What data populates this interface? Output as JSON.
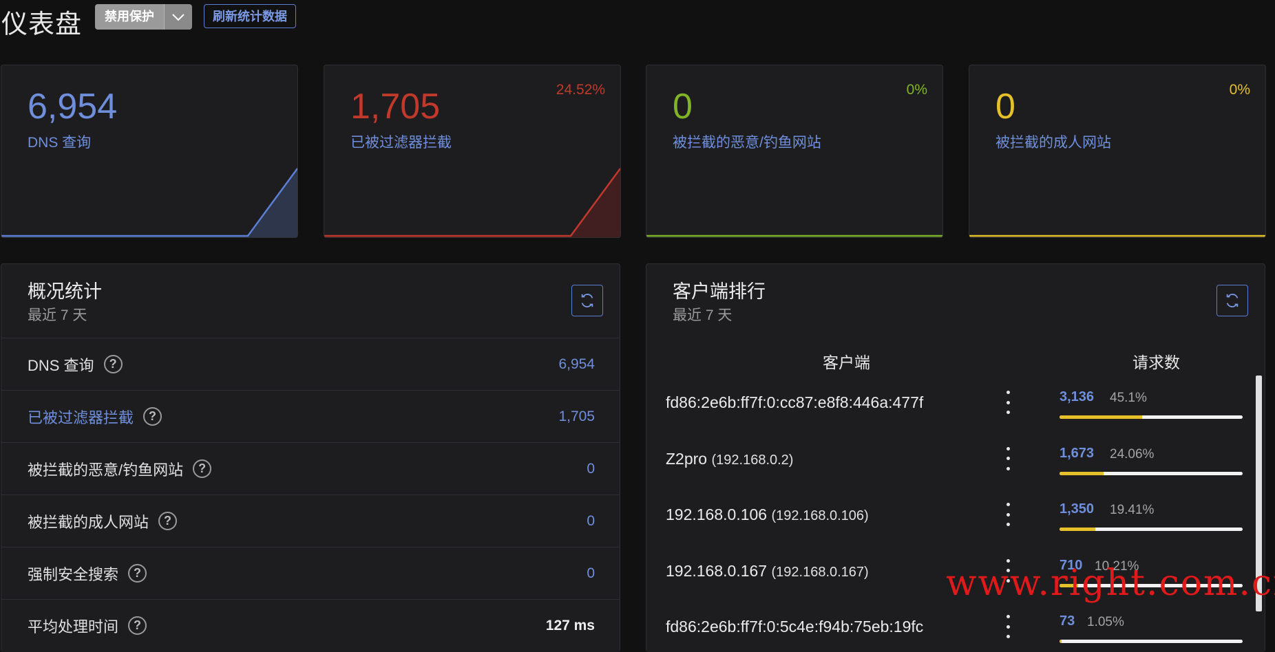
{
  "header": {
    "title": "仪表盘",
    "protect_button": "禁用保护",
    "refresh_button": "刷新统计数据"
  },
  "stat_cards": [
    {
      "value": "6,954",
      "label": "DNS 查询",
      "percent": "",
      "color": "#5b7fd4"
    },
    {
      "value": "1,705",
      "label": "已被过滤器拦截",
      "percent": "24.52%",
      "color": "#c0392b"
    },
    {
      "value": "0",
      "label": "被拦截的恶意/钓鱼网站",
      "percent": "0%",
      "color": "#7fb526"
    },
    {
      "value": "0",
      "label": "被拦截的成人网站",
      "percent": "0%",
      "color": "#e6c12a"
    }
  ],
  "overview": {
    "title": "概况统计",
    "subtitle": "最近 7 天",
    "rows": [
      {
        "label": "DNS 查询",
        "value": "6,954"
      },
      {
        "label": "已被过滤器拦截",
        "value": "1,705"
      },
      {
        "label": "被拦截的恶意/钓鱼网站",
        "value": "0"
      },
      {
        "label": "被拦截的成人网站",
        "value": "0"
      },
      {
        "label": "强制安全搜索",
        "value": "0"
      },
      {
        "label": "平均处理时间",
        "value": "127 ms"
      }
    ]
  },
  "clients": {
    "title": "客户端排行",
    "subtitle": "最近 7 天",
    "col_client": "客户端",
    "col_requests": "请求数",
    "rows": [
      {
        "name": "fd86:2e6b:ff7f:0:cc87:e8f8:446a:477f",
        "ip": "",
        "count": "3,136",
        "percent": "45.1%",
        "fraction": 0.451
      },
      {
        "name": "Z2pro",
        "ip": "(192.168.0.2)",
        "count": "1,673",
        "percent": "24.06%",
        "fraction": 0.2406
      },
      {
        "name": "192.168.0.106",
        "ip": "(192.168.0.106)",
        "count": "1,350",
        "percent": "19.41%",
        "fraction": 0.1941
      },
      {
        "name": "192.168.0.167",
        "ip": "(192.168.0.167)",
        "count": "710",
        "percent": "10.21%",
        "fraction": 0.1021
      },
      {
        "name": "fd86:2e6b:ff7f:0:5c4e:f94b:75eb:19fc",
        "ip": "",
        "count": "73",
        "percent": "1.05%",
        "fraction": 0.0105
      }
    ]
  },
  "watermark": "www.right.com.cn"
}
